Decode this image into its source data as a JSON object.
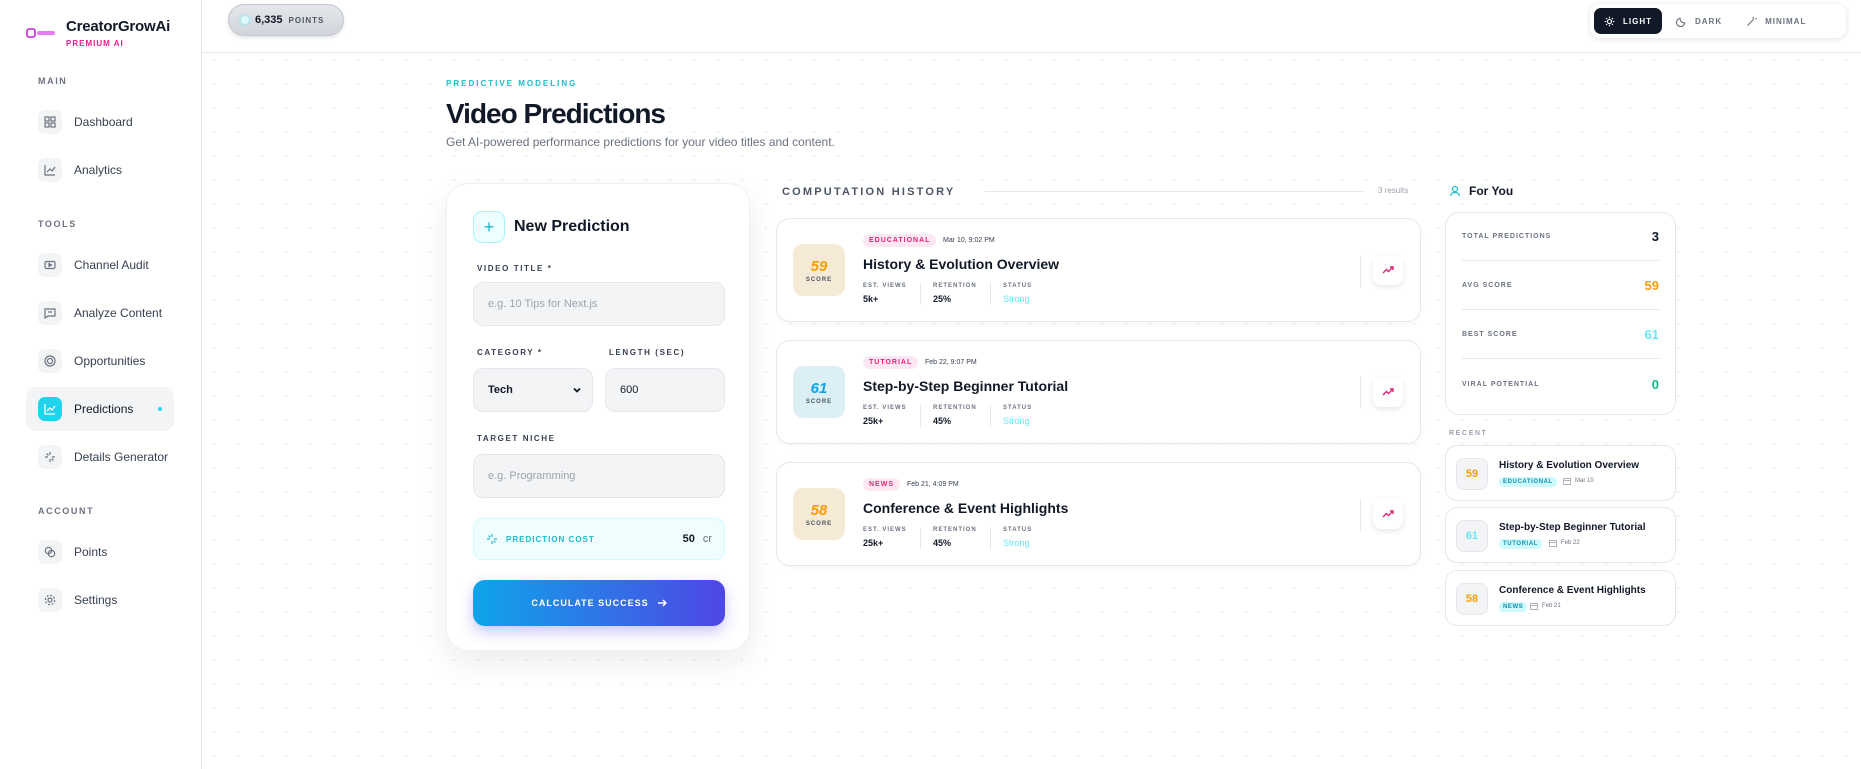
{
  "brand": {
    "name": "CreatorGrowAi",
    "tier": "PREMIUM AI"
  },
  "sidebar": {
    "sections": [
      {
        "label": "MAIN"
      },
      {
        "label": "TOOLS"
      },
      {
        "label": "ACCOUNT"
      }
    ],
    "items": [
      {
        "label": "Dashboard",
        "icon": "dashboard-icon"
      },
      {
        "label": "Analytics",
        "icon": "chart-line-icon"
      },
      {
        "label": "Channel Audit",
        "icon": "video-icon"
      },
      {
        "label": "Analyze Content",
        "icon": "message-icon"
      },
      {
        "label": "Opportunities",
        "icon": "target-icon"
      },
      {
        "label": "Predictions",
        "icon": "trend-icon",
        "active": true
      },
      {
        "label": "Details Generator",
        "icon": "sparkle-icon"
      },
      {
        "label": "Points",
        "icon": "coins-icon"
      },
      {
        "label": "Settings",
        "icon": "gear-icon"
      }
    ]
  },
  "topbar": {
    "points_value": "6,335",
    "points_label": "POINTS",
    "themes": [
      {
        "label": "LIGHT",
        "icon": "sun-icon",
        "selected": true
      },
      {
        "label": "DARK",
        "icon": "moon-icon"
      },
      {
        "label": "MINIMAL",
        "icon": "wand-icon"
      }
    ]
  },
  "header": {
    "eyebrow": "PREDICTIVE MODELING",
    "title": "Video Predictions",
    "subtitle": "Get AI-powered performance predictions for your video titles and content."
  },
  "form": {
    "title": "New Prediction",
    "video_title_label": "VIDEO TITLE *",
    "video_title_placeholder": "e.g. 10 Tips for Next.js",
    "category_label": "CATEGORY *",
    "category_value": "Tech",
    "length_label": "LENGTH (SEC)",
    "length_value": "600",
    "niche_label": "TARGET NICHE",
    "niche_placeholder": "e.g. Programming",
    "cost_label": "PREDICTION COST",
    "cost_value": "50",
    "cost_unit": "cr",
    "submit_label": "CALCULATE SUCCESS"
  },
  "history": {
    "heading": "COMPUTATION HISTORY",
    "count": "3 results",
    "score_label": "SCORE",
    "views_label": "EST. VIEWS",
    "retention_label": "RETENTION",
    "status_label": "STATUS",
    "items": [
      {
        "score": "59",
        "score_color": "#f59e0b",
        "score_bg": "#f5ead6",
        "tag": "EDUCATIONAL",
        "date": "Mar 10, 9:02 PM",
        "title": "History & Evolution Overview",
        "views": "5k+",
        "retention": "25%",
        "status": "Strong"
      },
      {
        "score": "61",
        "score_color": "#0ea5e9",
        "score_bg": "#dbeff5",
        "tag": "TUTORIAL",
        "date": "Feb 22, 9:07 PM",
        "title": "Step-by-Step Beginner Tutorial",
        "views": "25k+",
        "retention": "45%",
        "status": "Strong"
      },
      {
        "score": "58",
        "score_color": "#f59e0b",
        "score_bg": "#f5ead6",
        "tag": "NEWS",
        "date": "Feb 21, 4:09 PM",
        "title": "Conference & Event Highlights",
        "views": "25k+",
        "retention": "45%",
        "status": "Strong"
      }
    ]
  },
  "for_you": {
    "heading": "For You",
    "stats": [
      {
        "label": "TOTAL PREDICTIONS",
        "value": "3",
        "color": "#111827"
      },
      {
        "label": "AVG SCORE",
        "value": "59",
        "color": "#f59e0b"
      },
      {
        "label": "BEST SCORE",
        "value": "61",
        "color": "#67e8f9"
      },
      {
        "label": "VIRAL POTENTIAL",
        "value": "0",
        "color": "#10b981"
      }
    ],
    "recent_label": "RECENT",
    "recent": [
      {
        "score": "59",
        "score_color": "#f59e0b",
        "title": "History & Evolution Overview",
        "tag": "EDUCATIONAL",
        "date": "Mar 10"
      },
      {
        "score": "61",
        "score_color": "#67e8f9",
        "title": "Step-by-Step Beginner Tutorial",
        "tag": "TUTORIAL",
        "date": "Feb 22"
      },
      {
        "score": "58",
        "score_color": "#f59e0b",
        "title": "Conference & Event Highlights",
        "tag": "NEWS",
        "date": "Feb 21"
      }
    ]
  }
}
